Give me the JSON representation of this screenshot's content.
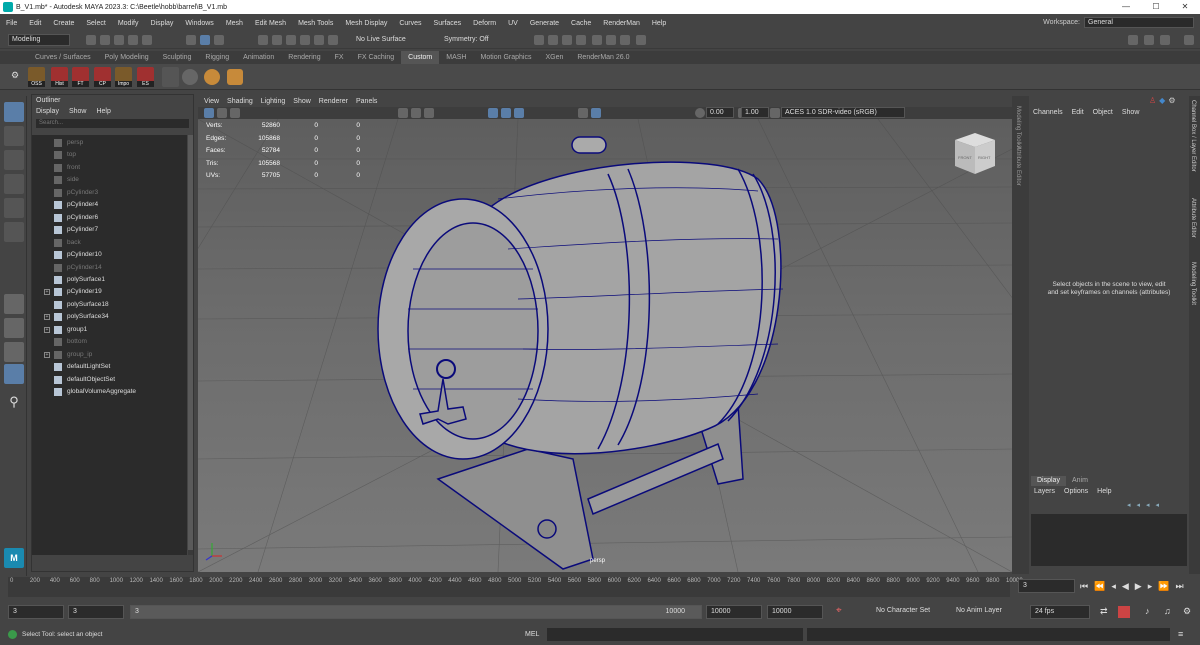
{
  "title": {
    "text": "B_V1.mb* - Autodesk MAYA 2023.3: C:\\Beetle\\hobb\\barrel\\B_V1.mb",
    "minimize": "—",
    "maximize": "☐",
    "close": "✕"
  },
  "menu": {
    "items": [
      "File",
      "Edit",
      "Create",
      "Select",
      "Modify",
      "Display",
      "Windows",
      "Mesh",
      "Edit Mesh",
      "Mesh Tools",
      "Mesh Display",
      "Curves",
      "Surfaces",
      "Deform",
      "UV",
      "Generate",
      "Cache",
      "RenderMan",
      "Help"
    ],
    "workspace_label": "Workspace:",
    "workspace_value": "General"
  },
  "statusline": {
    "mode": "Modeling",
    "live_surface": "No Live Surface",
    "symmetry": "Symmetry: Off"
  },
  "shelf": {
    "tabs": [
      "Curves / Surfaces",
      "Poly Modeling",
      "Sculpting",
      "Rigging",
      "Animation",
      "Rendering",
      "FX",
      "FX Caching",
      "Custom",
      "MASH",
      "Motion Graphics",
      "XGen",
      "RenderMan 26.0"
    ],
    "active_tab": "Custom",
    "buttons": [
      "OSS",
      "Hist",
      "FT",
      "CP",
      "Impo",
      "ES"
    ]
  },
  "outliner": {
    "title": "Outliner",
    "menu": [
      "Display",
      "Show",
      "Help"
    ],
    "search_placeholder": "Search...",
    "items": [
      {
        "label": "persp",
        "dim": true,
        "expand": false
      },
      {
        "label": "top",
        "dim": true,
        "expand": false
      },
      {
        "label": "front",
        "dim": true,
        "expand": false
      },
      {
        "label": "side",
        "dim": true,
        "expand": false
      },
      {
        "label": "pCylinder3",
        "dim": true,
        "expand": false
      },
      {
        "label": "pCylinder4",
        "dim": false,
        "expand": false
      },
      {
        "label": "pCylinder6",
        "dim": false,
        "expand": false
      },
      {
        "label": "pCylinder7",
        "dim": false,
        "expand": false
      },
      {
        "label": "back",
        "dim": true,
        "expand": false
      },
      {
        "label": "pCylinder10",
        "dim": false,
        "expand": false
      },
      {
        "label": "pCylinder14",
        "dim": true,
        "expand": false
      },
      {
        "label": "polySurface1",
        "dim": false,
        "expand": false
      },
      {
        "label": "pCylinder19",
        "dim": false,
        "expand": true
      },
      {
        "label": "polySurface18",
        "dim": false,
        "expand": false
      },
      {
        "label": "polySurface34",
        "dim": false,
        "expand": true
      },
      {
        "label": "group1",
        "dim": false,
        "expand": true
      },
      {
        "label": "bottom",
        "dim": true,
        "expand": false
      },
      {
        "label": "group_ip",
        "dim": true,
        "expand": true
      },
      {
        "label": "defaultLightSet",
        "dim": false,
        "expand": false
      },
      {
        "label": "defaultObjectSet",
        "dim": false,
        "expand": false
      },
      {
        "label": "globalVolumeAggregate",
        "dim": false,
        "expand": false
      }
    ]
  },
  "viewport": {
    "menu": [
      "View",
      "Shading",
      "Lighting",
      "Show",
      "Renderer",
      "Panels"
    ],
    "exposure": "0.00",
    "gamma": "1.00",
    "colorspace": "ACES 1.0 SDR-video (sRGB)",
    "camera": "persp",
    "hud": [
      {
        "k": "Verts:",
        "v": "52860",
        "c": "0",
        "d": "0"
      },
      {
        "k": "Edges:",
        "v": "105868",
        "c": "0",
        "d": "0"
      },
      {
        "k": "Faces:",
        "v": "52784",
        "c": "0",
        "d": "0"
      },
      {
        "k": "Tris:",
        "v": "105568",
        "c": "0",
        "d": "0"
      },
      {
        "k": "UVs:",
        "v": "57705",
        "c": "0",
        "d": "0"
      }
    ],
    "viewcube_front": "FRONT",
    "viewcube_right": "RIGHT"
  },
  "right_strip": [
    "Modeling Toolkit",
    "Attribute Editor"
  ],
  "far_right": [
    "Channel Box / Layer Editor",
    "Attribute Editor",
    "Modeling Toolkit"
  ],
  "channel_box": {
    "menu": [
      "Channels",
      "Edit",
      "Object",
      "Show"
    ],
    "message": "Select objects in the scene to view, edit and set keyframes on channels (attributes)"
  },
  "layer_editor": {
    "tabs": [
      "Display",
      "Anim"
    ],
    "menu": [
      "Layers",
      "Options",
      "Help"
    ]
  },
  "timeline": {
    "ticks": [
      "0",
      "200",
      "400",
      "600",
      "800",
      "1000",
      "1200",
      "1400",
      "1600",
      "1800",
      "2000",
      "2200",
      "2400",
      "2600",
      "2800",
      "3000",
      "3200",
      "3400",
      "3600",
      "3800",
      "4000",
      "4200",
      "4400",
      "4600",
      "4800",
      "5000",
      "5200",
      "5400",
      "5600",
      "5800",
      "6000",
      "6200",
      "6400",
      "6600",
      "6800",
      "7000",
      "7200",
      "7400",
      "7600",
      "7800",
      "8000",
      "8200",
      "8400",
      "8600",
      "8800",
      "9000",
      "9200",
      "9400",
      "9600",
      "9800",
      "10000"
    ],
    "current_frame": "3"
  },
  "range": {
    "start": "3",
    "playback_start": "3",
    "slider_start": "3",
    "slider_end": "10000",
    "playback_end": "10000",
    "end": "10000",
    "character_set": "No Character Set",
    "anim_layer": "No Anim Layer",
    "fps": "24 fps"
  },
  "command": {
    "help": "Select Tool: select an object",
    "mel": "MEL"
  },
  "colors": {
    "wire": "#0a0a7a",
    "accent": "#4a6a8a",
    "barrel": "#a8a8a8"
  }
}
